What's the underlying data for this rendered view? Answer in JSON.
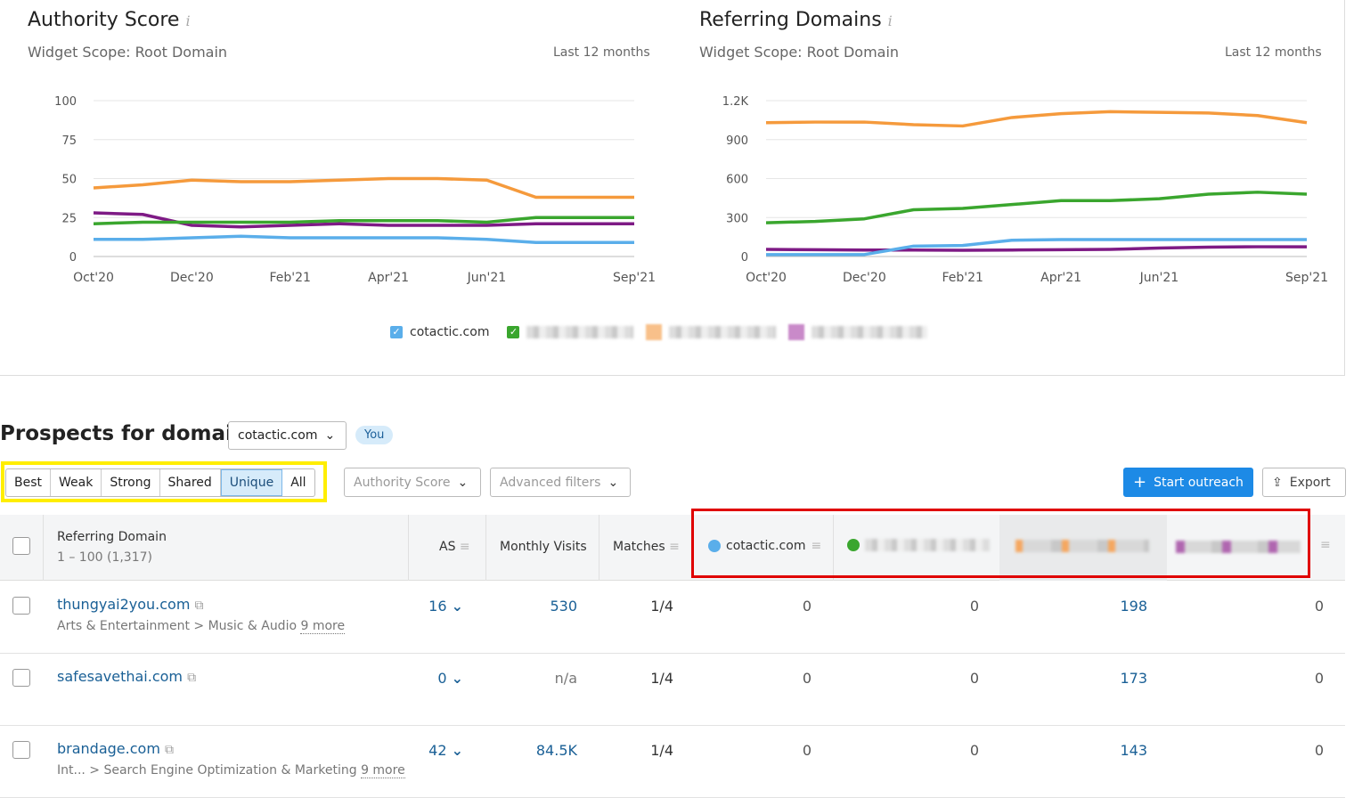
{
  "widgets": [
    {
      "title": "Authority Score",
      "scope": "Widget Scope: Root Domain",
      "range": "Last 12 months"
    },
    {
      "title": "Referring Domains",
      "scope": "Widget Scope: Root Domain",
      "range": "Last 12 months"
    }
  ],
  "chart_data": [
    {
      "type": "line",
      "title": "Authority Score",
      "x": [
        "Oct'20",
        "Nov'20",
        "Dec'20",
        "Jan'21",
        "Feb'21",
        "Mar'21",
        "Apr'21",
        "May'21",
        "Jun'21",
        "Jul'21",
        "Aug'21",
        "Sep'21"
      ],
      "xticks": [
        "Oct'20",
        "Dec'20",
        "Feb'21",
        "Apr'21",
        "Jun'21",
        "Sep'21"
      ],
      "yticks": [
        "0",
        "25",
        "50",
        "75",
        "100"
      ],
      "ylim": [
        0,
        100
      ],
      "grid": true,
      "series": [
        {
          "name": "cotactic.com",
          "color": "#5aaeea",
          "values": [
            11,
            11,
            12,
            13,
            12,
            12,
            12,
            12,
            11,
            9,
            9,
            9
          ]
        },
        {
          "color": "#3aa62e",
          "values": [
            21,
            22,
            22,
            22,
            22,
            23,
            23,
            23,
            22,
            25,
            25,
            25
          ]
        },
        {
          "color": "#f59a3c",
          "values": [
            44,
            46,
            49,
            48,
            48,
            49,
            50,
            50,
            49,
            38,
            38,
            38
          ]
        },
        {
          "color": "#7e1a85",
          "values": [
            28,
            27,
            20,
            19,
            20,
            21,
            20,
            20,
            20,
            21,
            21,
            21
          ]
        }
      ]
    },
    {
      "type": "line",
      "title": "Referring Domains",
      "x": [
        "Oct'20",
        "Nov'20",
        "Dec'20",
        "Jan'21",
        "Feb'21",
        "Mar'21",
        "Apr'21",
        "May'21",
        "Jun'21",
        "Jul'21",
        "Aug'21",
        "Sep'21"
      ],
      "xticks": [
        "Oct'20",
        "Dec'20",
        "Feb'21",
        "Apr'21",
        "Jun'21",
        "Sep'21"
      ],
      "yticks": [
        "0",
        "300",
        "600",
        "900",
        "1.2K"
      ],
      "ylim": [
        0,
        1200
      ],
      "grid": true,
      "series": [
        {
          "name": "cotactic.com",
          "color": "#5aaeea",
          "values": [
            15,
            15,
            15,
            80,
            85,
            125,
            130,
            130,
            130,
            130,
            130,
            130
          ]
        },
        {
          "color": "#3aa62e",
          "values": [
            260,
            270,
            290,
            360,
            370,
            400,
            430,
            430,
            445,
            480,
            495,
            480
          ]
        },
        {
          "color": "#f59a3c",
          "values": [
            1030,
            1035,
            1035,
            1015,
            1005,
            1070,
            1100,
            1115,
            1110,
            1105,
            1085,
            1030
          ]
        },
        {
          "color": "#7e1a85",
          "values": [
            55,
            52,
            50,
            50,
            48,
            50,
            52,
            55,
            65,
            72,
            75,
            75
          ]
        }
      ]
    }
  ],
  "legend": {
    "first": "cotactic.com"
  },
  "prospects": {
    "title": "Prospects for domain:",
    "domain": "cotactic.com",
    "badge": "You",
    "tabs": [
      "Best",
      "Weak",
      "Strong",
      "Shared",
      "Unique",
      "All"
    ],
    "active_tab": "Unique",
    "filters": [
      "Authority Score",
      "Advanced filters"
    ],
    "start_outreach": "Start outreach",
    "export": "Export"
  },
  "table": {
    "headers": {
      "domain": "Referring Domain",
      "count": "1 – 100 (1,317)",
      "as": "AS",
      "visits": "Monthly Visits",
      "matches": "Matches",
      "you": "cotactic.com"
    },
    "rows": [
      {
        "domain": "thungyai2you.com",
        "cat": "Arts & Entertainment > Music & Audio",
        "more": "9 more",
        "as": "16",
        "visits": "530",
        "matches": "1/4",
        "c1": "0",
        "c2": "0",
        "c3": "198",
        "c4": "0"
      },
      {
        "domain": "safesavethai.com",
        "cat": "",
        "more": "",
        "as": "0",
        "visits": "n/a",
        "matches": "1/4",
        "c1": "0",
        "c2": "0",
        "c3": "173",
        "c4": "0"
      },
      {
        "domain": "brandage.com",
        "cat": "Int... > Search Engine Optimization & Marketing",
        "more": "9 more",
        "as": "42",
        "visits": "84.5K",
        "matches": "1/4",
        "c1": "0",
        "c2": "0",
        "c3": "143",
        "c4": "0"
      }
    ]
  }
}
